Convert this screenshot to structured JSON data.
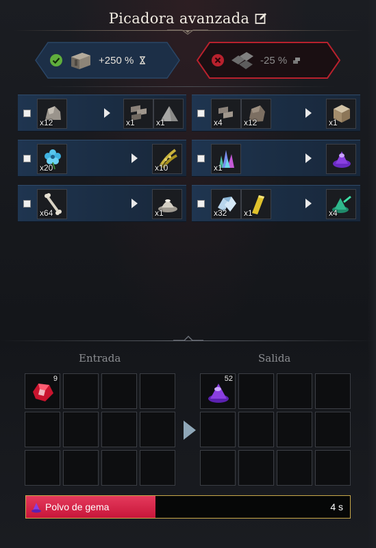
{
  "header": {
    "title": "Picadora avanzada",
    "edit_icon": "edit-icon"
  },
  "modifiers": {
    "bonus": {
      "icon": "crate-icon",
      "value": "+250 %",
      "unit_icon": "hourglass-icon",
      "status": "active",
      "status_color": "#5fae3c"
    },
    "penalty": {
      "icon": "plates-icon",
      "value": "-25 %",
      "unit_icon": "coins-icon",
      "status": "inactive",
      "status_color": "#b8212d"
    }
  },
  "recipes": [
    {
      "inputs": [
        {
          "icon": "stone-icon",
          "qty": "x12"
        }
      ],
      "outputs": [
        {
          "icon": "bricks-icon",
          "qty": "x1"
        },
        {
          "icon": "gravel-icon",
          "qty": "x1"
        }
      ]
    },
    {
      "inputs": [
        {
          "icon": "bricks-icon",
          "qty": "x4"
        },
        {
          "icon": "rock-icon",
          "qty": "x12"
        }
      ],
      "outputs": [
        {
          "icon": "block-icon",
          "qty": "x1"
        }
      ]
    },
    {
      "inputs": [
        {
          "icon": "blue-flower-icon",
          "qty": "x20"
        }
      ],
      "outputs": [
        {
          "icon": "seeds-icon",
          "qty": "x10"
        }
      ]
    },
    {
      "inputs": [
        {
          "icon": "crystal-cluster-icon",
          "qty": "x1"
        }
      ],
      "outputs": [
        {
          "icon": "purple-dust-icon",
          "qty": ""
        }
      ]
    },
    {
      "inputs": [
        {
          "icon": "bone-icon",
          "qty": "x64"
        }
      ],
      "outputs": [
        {
          "icon": "bone-meal-icon",
          "qty": "x1"
        }
      ]
    },
    {
      "inputs": [
        {
          "icon": "ice-crystal-icon",
          "qty": "x32"
        },
        {
          "icon": "gold-bar-icon",
          "qty": "x1"
        }
      ],
      "outputs": [
        {
          "icon": "green-dust-icon",
          "qty": "x4"
        }
      ]
    }
  ],
  "input_panel": {
    "label": "Entrada",
    "items": [
      {
        "icon": "ruby-icon",
        "count": "9"
      }
    ]
  },
  "output_panel": {
    "label": "Salida",
    "items": [
      {
        "icon": "purple-dust-icon",
        "count": "52"
      }
    ]
  },
  "progress": {
    "icon": "gem-dust-icon",
    "label": "Polvo de gema",
    "time": "4 s",
    "fraction": 0.4,
    "fill_color": "#d9214a"
  }
}
